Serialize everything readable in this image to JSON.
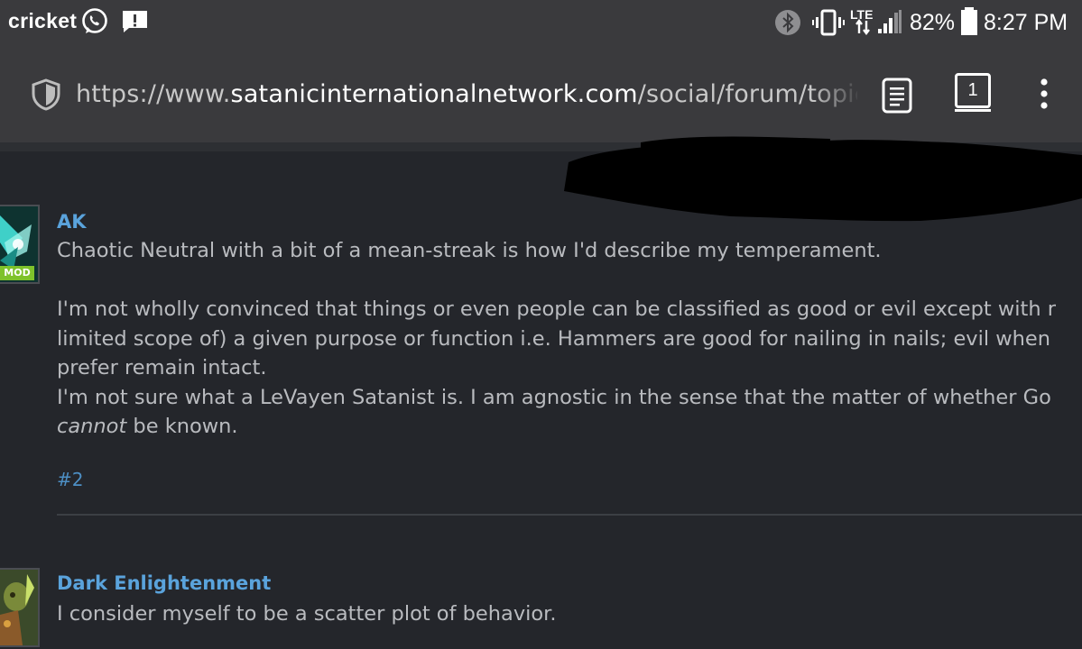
{
  "status_bar": {
    "carrier": "cricket",
    "network_label": "LTE",
    "battery": "82%",
    "time": "8:27 PM",
    "icons": [
      "whatsapp-icon",
      "notification-alert-icon",
      "bluetooth-icon",
      "vibrate-icon",
      "lte-icon",
      "signal-icon",
      "battery-icon"
    ]
  },
  "browser": {
    "url_prefix": "https://www.",
    "url_domain": "satanicinternationalnetwork.com",
    "url_path": "/social/forum/topic/",
    "tab_count": "1",
    "icons": [
      "shield-icon",
      "reader-mode-icon",
      "tabs-icon",
      "more-options-icon"
    ]
  },
  "posts": [
    {
      "username": "AK",
      "badge": "MOD",
      "lines": [
        "Chaotic Neutral with a bit of a mean-streak is how I'd describe my temperament.",
        "I'm not wholly convinced that things or even people can be classified as good or evil except with r",
        "limited scope of) a given purpose or function i.e. Hammers are good for nailing in nails; evil when",
        "prefer remain intact.",
        "I'm not sure what a LeVayen Satanist is. I am agnostic in the sense that the matter of whether Go"
      ],
      "last_line_emphasis": "cannot",
      "last_line_rest": " be known.",
      "post_number": "#2"
    },
    {
      "username": "Dark Enlightenment",
      "lines": [
        "I consider myself to be a scatter plot of behavior."
      ]
    }
  ],
  "colors": {
    "background": "#24262b",
    "toolbar": "#3a3a3d",
    "username": "#5aa3dc",
    "body_text": "#b9bbbf",
    "mod_badge": "#7ec22b"
  }
}
